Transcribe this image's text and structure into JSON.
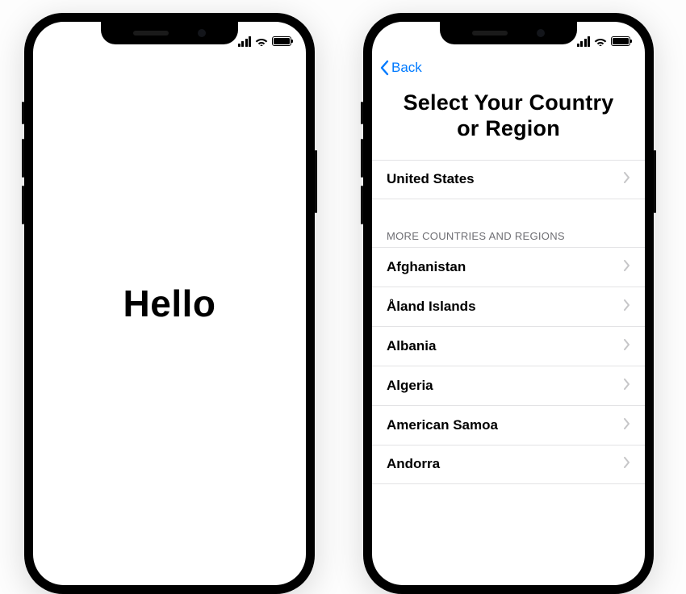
{
  "status": {
    "signal_bars": 4,
    "wifi": true,
    "battery_full": true
  },
  "left_screen": {
    "greeting": "Hello"
  },
  "right_screen": {
    "back_label": "Back",
    "title": "Select Your Country or Region",
    "suggested_country": "United States",
    "more_header": "MORE COUNTRIES AND REGIONS",
    "countries": [
      "Afghanistan",
      "Åland Islands",
      "Albania",
      "Algeria",
      "American Samoa",
      "Andorra"
    ]
  },
  "colors": {
    "link_blue": "#007aff",
    "separator": "#e3e3e5",
    "secondary_text": "#6e6e73"
  }
}
